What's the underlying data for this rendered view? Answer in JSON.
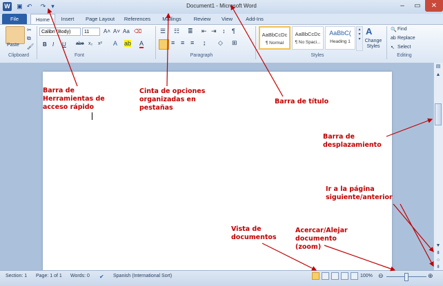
{
  "window": {
    "title": "Document1 - Microsoft Word",
    "app_icon": "W",
    "quick_access": {
      "save": "save-icon",
      "undo": "undo-icon",
      "redo": "redo-icon",
      "customize": "customize-icon"
    }
  },
  "tabs": [
    "File",
    "Home",
    "Insert",
    "Page Layout",
    "References",
    "Mailings",
    "Review",
    "View",
    "Add-Ins"
  ],
  "ribbon": {
    "clipboard": {
      "paste": "Paste",
      "label": "Clipboard"
    },
    "font": {
      "name": "Calibri (Body)",
      "size": "11",
      "label": "Font",
      "buttons": [
        "B",
        "I",
        "U",
        "abe",
        "x₂",
        "x²"
      ]
    },
    "paragraph": {
      "label": "Paragraph"
    },
    "styles": {
      "label": "Styles",
      "tiles": [
        {
          "sample": "AaBbCcDc",
          "name": "¶ Normal"
        },
        {
          "sample": "AaBbCcDc",
          "name": "¶ No Spaci..."
        },
        {
          "sample": "AaBbC(",
          "name": "Heading 1"
        }
      ],
      "change_styles": "Change Styles"
    },
    "editing": {
      "label": "Editing",
      "find": "Find",
      "replace": "Replace",
      "select": "Select"
    }
  },
  "annotations": [
    "Barra  de  Herramientas de acceso rápido",
    "Cinta de opciones organizadas en pestañas",
    "Barra de título",
    "Barra de desplazamiento",
    "Ir a la página siguiente/anterior",
    "Vista de documentos",
    "Acercar/Alejar documento (zoom)"
  ],
  "status": {
    "section": "Section: 1",
    "page": "Page: 1 of 1",
    "words": "Words: 0",
    "language": "Spanish (International Sort)",
    "zoom": "100%"
  },
  "colors": {
    "accent": "#2a5ea8",
    "annotation": "#c00000"
  }
}
